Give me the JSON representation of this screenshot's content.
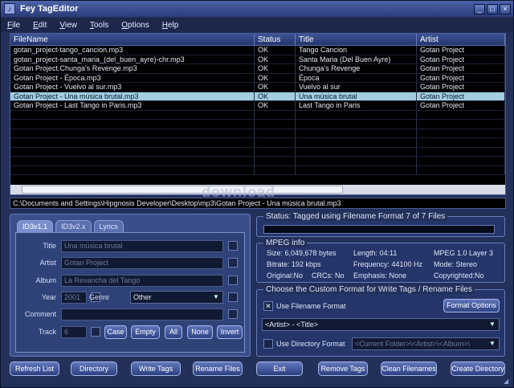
{
  "window": {
    "title": "Fey TagEditor",
    "min": "_",
    "max": "□",
    "close": "×"
  },
  "menu": [
    "File",
    "Edit",
    "View",
    "Tools",
    "Options",
    "Help"
  ],
  "list": {
    "columns": [
      "FileName",
      "Status",
      "Title",
      "Artist"
    ],
    "rows": [
      [
        "gotan_project-tango_cancion.mp3",
        "OK",
        "Tango Cancion",
        "Gotan Project"
      ],
      [
        "gotan_project-santa_maria_(del_buen_ayre)-chr.mp3",
        "OK",
        "Santa Maria (Del Buen Ayre)",
        "Gotan Project"
      ],
      [
        "Gotan Project.Chunga's Revenge.mp3",
        "OK",
        "Chunga's Revenge",
        "Gotan Project"
      ],
      [
        "Gotan Project - Época.mp3",
        "OK",
        "Época",
        "Gotan Project"
      ],
      [
        "Gotan Project - Vuelvo al sur.mp3",
        "OK",
        "Vuelvo al sur",
        "Gotan Project"
      ],
      [
        "Gotan Project - Una música brutal.mp3",
        "OK",
        "Una música brutal",
        "Gotan Project"
      ],
      [
        "Gotan Project - Last Tango in Paris.mp3",
        "OK",
        "Last Tango in Paris",
        "Gotan Project"
      ]
    ],
    "selected_index": 5
  },
  "path": "C:\\Documents and Settings\\Hipgnosis Developer\\Desktop\\mp3\\Gotan Project - Una música brutal.mp3",
  "watermark": "download",
  "tabs": [
    "ID3v1.1",
    "ID3v2.x",
    "Lyrics"
  ],
  "tag": {
    "title_label": "Title",
    "title_value": "Una música brutal",
    "artist_label": "Artist",
    "artist_value": "Gotan Project",
    "album_label": "Album",
    "album_value": "La Revancha del Tango",
    "year_label": "Year",
    "year_value": "2001",
    "genre_label": "Genre",
    "genre_value": "Other",
    "comment_label": "Comment",
    "comment_value": "",
    "track_label": "Track",
    "track_value": "6"
  },
  "case_buttons": [
    "Case",
    "Empty",
    "All",
    "None",
    "Invert"
  ],
  "status": {
    "label": "Status: Tagged using Filename Format 7 of 7 Files"
  },
  "mpeg": {
    "label": "MPEG info",
    "size": "Size: 6,049,678 bytes",
    "length": "Length: 04:11",
    "version": "MPEG 1.0 Layer 3",
    "bitrate": "Bitrate: 192 kbps",
    "frequency": "Frequency: 44100 Hz",
    "mode": "Mode: Stereo",
    "original": "Original:No",
    "crcs": "CRCs: No",
    "emphasis": "Emphasis: None",
    "copyrighted": "Copyrighted:No"
  },
  "format": {
    "label": "Choose the Custom Format for Write Tags / Rename Files",
    "use_filename": "Use Filename Format",
    "format_options": "Format Options",
    "filename_format": "<Artist> - <Title>",
    "use_directory": "Use Directory Format",
    "directory_format": "<Current Folder>\\<Artist>\\<Album>\\"
  },
  "bottom_buttons": [
    "Refresh List",
    "Directory",
    "Write Tags",
    "Rename Files",
    "Exit",
    "Remove Tags",
    "Clean Filenames",
    "Create Directory"
  ]
}
